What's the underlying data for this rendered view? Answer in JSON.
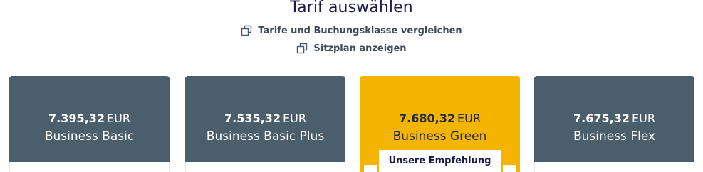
{
  "header": {
    "title": "Tarif auswählen",
    "compare_link": "Tarife und Buchungsklasse vergleichen",
    "seatmap_link": "Sitzplan anzeigen"
  },
  "colors": {
    "card_dark": "#4b5e6b",
    "card_highlight": "#f5b400",
    "title_text": "#1b1b4d"
  },
  "fares": [
    {
      "amount": "7.395,32",
      "currency": "EUR",
      "name": "Business Basic"
    },
    {
      "amount": "7.535,32",
      "currency": "EUR",
      "name": "Business Basic Plus"
    },
    {
      "amount": "7.680,32",
      "currency": "EUR",
      "name": "Business Green",
      "badge": "Unsere Empfehlung"
    },
    {
      "amount": "7.675,32",
      "currency": "EUR",
      "name": "Business Flex"
    }
  ]
}
